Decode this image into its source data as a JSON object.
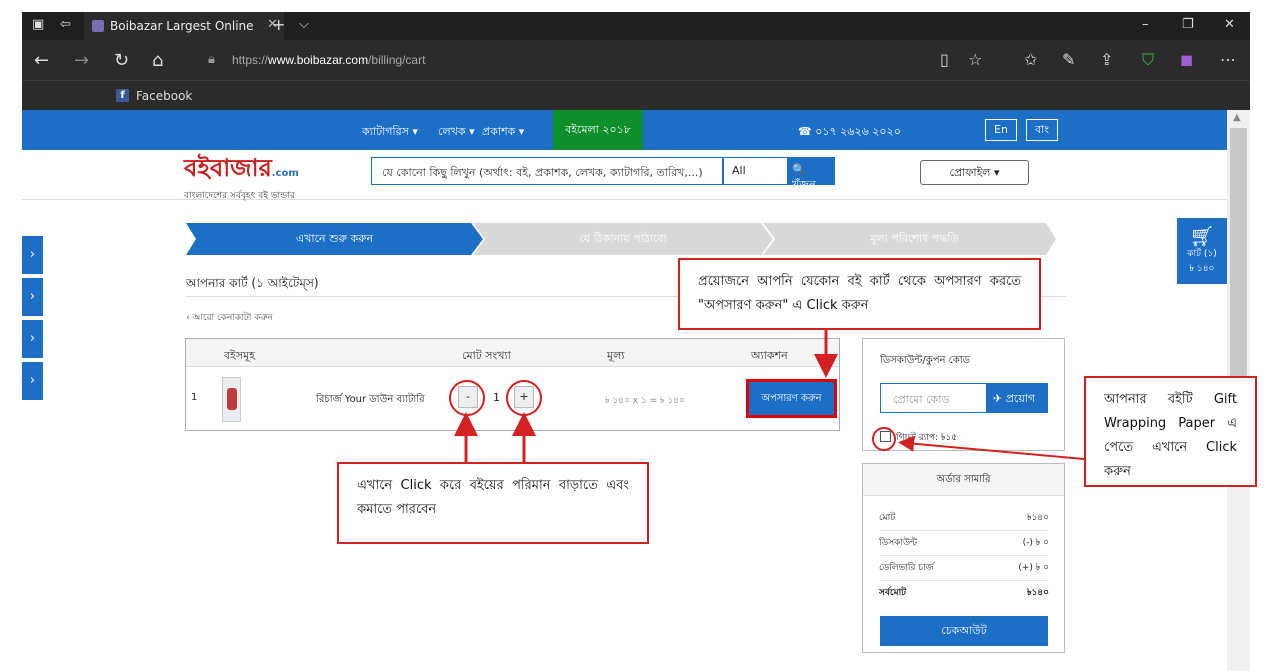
{
  "browser": {
    "tab_title": "Boibazar Largest Online",
    "new_tab": "+",
    "dropdown": "⌵",
    "url_prefix": "https://",
    "url_host": "www.boibazar.com",
    "url_path": "/billing/cart",
    "favorite": "Facebook",
    "win_min": "–",
    "win_max": "❐",
    "win_close": "✕"
  },
  "nav": {
    "categories": "ক্যাটাগরিস ▾",
    "writer": "লেখক ▾",
    "publisher": "প্রকাশক ▾",
    "fair": "বইমেলা ২০১৮",
    "phone": "☎ ০১৭ ২৬২৬ ২০২০",
    "lang_en": "En",
    "lang_bn": "বাং"
  },
  "logo": {
    "name_a": "বইবাজার",
    "name_b": ".com",
    "tagline": "বাংলাদেশের সর্ববৃহৎ বই ভান্ডার"
  },
  "search": {
    "placeholder": "যে কোনো কিছু লিখুন (অর্থাৎ: বই, প্রকাশক, লেখক, ক্যাটাগরি, তারিখ,...)",
    "scope": "All",
    "button": "🔍 খুঁজুন"
  },
  "profile": "প্রোফাইল ▾",
  "steps": [
    "এখানে শুরু করুন",
    "যে ঠিকানায় পাঠাবো",
    "মূল্য পরিশোধ পদ্ধতি"
  ],
  "cart_float": {
    "label": "কার্ট (১)",
    "amount": "৳ ১৪০"
  },
  "cart": {
    "title": "আপনার কার্ট (১ আইটেম্স)",
    "back": "‹   আরো কেনাকাটা করুন",
    "headers": [
      "বইসমূহ",
      "মোট সংখ্যা",
      "মূল্য",
      "অ্যাকশন"
    ],
    "row": {
      "index": "1",
      "book": "রিচার্জ Your ডাউন ব্যাটারি",
      "minus": "-",
      "qty": "1",
      "plus": "+",
      "price": "৳ ১৪০ x ১ = ৳ ১৪০",
      "remove": "অপসারণ করুন"
    }
  },
  "coupon": {
    "title": "ডিসকাউন্ট/কুপন কোড",
    "placeholder": "প্রোমো কোড",
    "apply": "✈ প্রয়োগ",
    "gift": "গিফট র‍্যাপ: ৳১৫"
  },
  "summary": {
    "title": "অর্ডার সামারি",
    "rows": [
      {
        "label": "মোট",
        "value": "৳১৪০"
      },
      {
        "label": "ডিসকাউন্ট",
        "value": "(-) ৳ ০"
      },
      {
        "label": "ডেলিভারি চার্জ",
        "value": "(+) ৳ ০"
      },
      {
        "label": "সর্বমোট",
        "value": "৳১৪০"
      }
    ],
    "checkout": "চেকআউট"
  },
  "annotations": {
    "remove_note": "প্রয়োজনে আপনি যেকোন বই কার্ট থেকে অপসারণ করতে \"অপসারণ করুন\" এ Click করুন",
    "qty_note": "এখানে Click করে বইয়ের পরিমান বাড়াতে এবং কমাতে পারবেন",
    "gift_note": "আপনার বইটি Gift Wrapping Paper এ পেতে এখানে Click করুন"
  },
  "colors": {
    "brand": "#1d6fc5",
    "fair_green": "#0f8f2c",
    "annotation_red": "#d32020"
  }
}
